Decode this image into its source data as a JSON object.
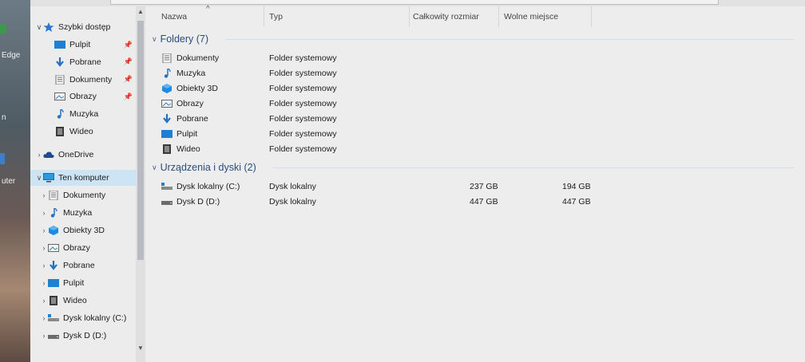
{
  "desktop": {
    "labels": [
      "Edge",
      "n",
      "uter"
    ]
  },
  "nav": {
    "quick_access": {
      "label": "Szybki dostęp",
      "items": [
        {
          "label": "Pulpit",
          "icon": "desktop-folder-icon",
          "pinned": true
        },
        {
          "label": "Pobrane",
          "icon": "download-arrow-icon",
          "pinned": true
        },
        {
          "label": "Dokumenty",
          "icon": "document-icon",
          "pinned": true
        },
        {
          "label": "Obrazy",
          "icon": "pictures-icon",
          "pinned": true
        },
        {
          "label": "Muzyka",
          "icon": "music-note-icon",
          "pinned": false
        },
        {
          "label": "Wideo",
          "icon": "video-icon",
          "pinned": false
        }
      ]
    },
    "onedrive": {
      "label": "OneDrive"
    },
    "this_pc": {
      "label": "Ten komputer",
      "items": [
        {
          "label": "Dokumenty",
          "icon": "document-icon"
        },
        {
          "label": "Muzyka",
          "icon": "music-note-icon"
        },
        {
          "label": "Obiekty 3D",
          "icon": "objects-3d-icon"
        },
        {
          "label": "Obrazy",
          "icon": "pictures-icon"
        },
        {
          "label": "Pobrane",
          "icon": "download-arrow-icon"
        },
        {
          "label": "Pulpit",
          "icon": "desktop-folder-icon"
        },
        {
          "label": "Wideo",
          "icon": "video-icon"
        },
        {
          "label": "Dysk lokalny (C:)",
          "icon": "local-disk-icon"
        },
        {
          "label": "Dysk D (D:)",
          "icon": "drive-icon"
        }
      ]
    }
  },
  "columns": {
    "name": "Nazwa",
    "type": "Typ",
    "total_size": "Całkowity rozmiar",
    "free_space": "Wolne miejsce"
  },
  "groups": {
    "folders": {
      "label": "Foldery (7)",
      "items": [
        {
          "name": "Dokumenty",
          "type": "Folder systemowy",
          "icon": "document-icon"
        },
        {
          "name": "Muzyka",
          "type": "Folder systemowy",
          "icon": "music-note-icon"
        },
        {
          "name": "Obiekty 3D",
          "type": "Folder systemowy",
          "icon": "objects-3d-icon"
        },
        {
          "name": "Obrazy",
          "type": "Folder systemowy",
          "icon": "pictures-icon"
        },
        {
          "name": "Pobrane",
          "type": "Folder systemowy",
          "icon": "download-arrow-icon"
        },
        {
          "name": "Pulpit",
          "type": "Folder systemowy",
          "icon": "desktop-folder-icon"
        },
        {
          "name": "Wideo",
          "type": "Folder systemowy",
          "icon": "video-icon"
        }
      ]
    },
    "drives": {
      "label": "Urządzenia i dyski (2)",
      "items": [
        {
          "name": "Dysk lokalny (C:)",
          "type": "Dysk lokalny",
          "total": "237 GB",
          "free": "194 GB",
          "icon": "local-disk-icon"
        },
        {
          "name": "Dysk D (D:)",
          "type": "Dysk lokalny",
          "total": "447 GB",
          "free": "447 GB",
          "icon": "drive-icon"
        }
      ]
    }
  },
  "colors": {
    "accent_blue": "#1f7fd1",
    "selection": "#cce4f4",
    "group_header": "#2a4d7a"
  }
}
